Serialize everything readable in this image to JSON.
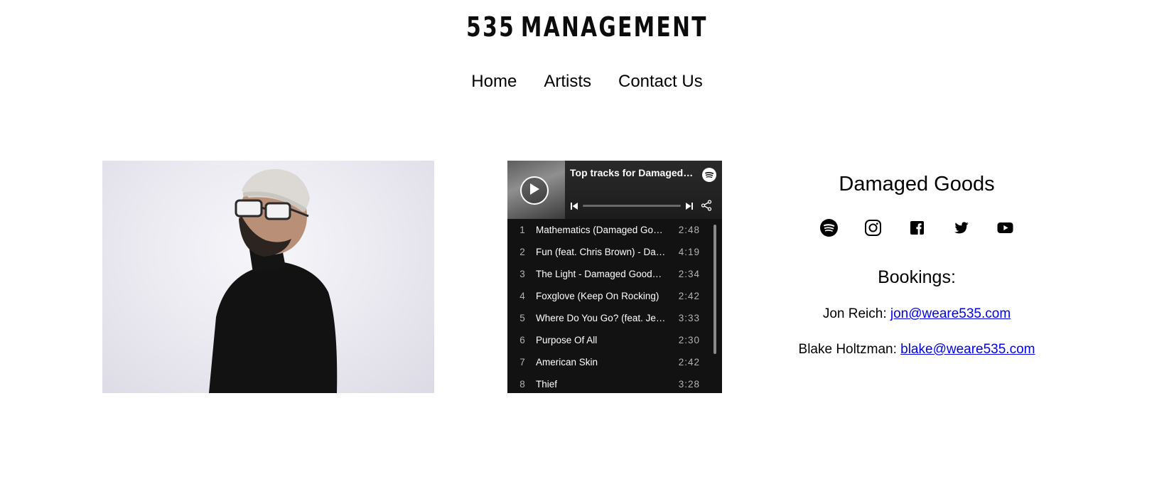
{
  "header": {
    "logo_number": "535",
    "logo_word": "MANAGEMENT"
  },
  "nav": {
    "items": [
      "Home",
      "Artists",
      "Contact Us"
    ]
  },
  "spotify_widget": {
    "title": "Top tracks for Damaged Goods",
    "tracks": [
      {
        "num": "1",
        "name": "Mathematics (Damaged Goods Remix)",
        "duration": "2:48"
      },
      {
        "num": "2",
        "name": "Fun (feat. Chris Brown) - Damaged Goods Remix",
        "duration": "4:19"
      },
      {
        "num": "3",
        "name": "The Light - Damaged Goods Remix",
        "duration": "2:34"
      },
      {
        "num": "4",
        "name": "Foxglove (Keep On Rocking)",
        "duration": "2:42"
      },
      {
        "num": "5",
        "name": "Where Do You Go? (feat. Jessie Ware)",
        "duration": "3:33"
      },
      {
        "num": "6",
        "name": "Purpose Of All",
        "duration": "2:30"
      },
      {
        "num": "7",
        "name": "American Skin",
        "duration": "2:42"
      },
      {
        "num": "8",
        "name": "Thief",
        "duration": "3:28"
      }
    ],
    "icons": {
      "play": "play-icon",
      "logo": "spotify-logo-icon",
      "prev": "skip-previous-icon",
      "next": "skip-next-icon",
      "share": "share-icon"
    },
    "colors": {
      "background": "#121212",
      "header": "#1c1c1c"
    }
  },
  "artist": {
    "name": "Damaged Goods",
    "socials": [
      "spotify-icon",
      "instagram-icon",
      "facebook-icon",
      "twitter-icon",
      "youtube-icon"
    ],
    "bookings_heading": "Bookings:",
    "contacts": [
      {
        "label": "Jon Reich:",
        "email": "jon@weare535.com"
      },
      {
        "label": "Blake Holtzman:",
        "email": "blake@weare535.com"
      }
    ]
  },
  "colors": {
    "link": "#0000ee",
    "text": "#000000"
  }
}
